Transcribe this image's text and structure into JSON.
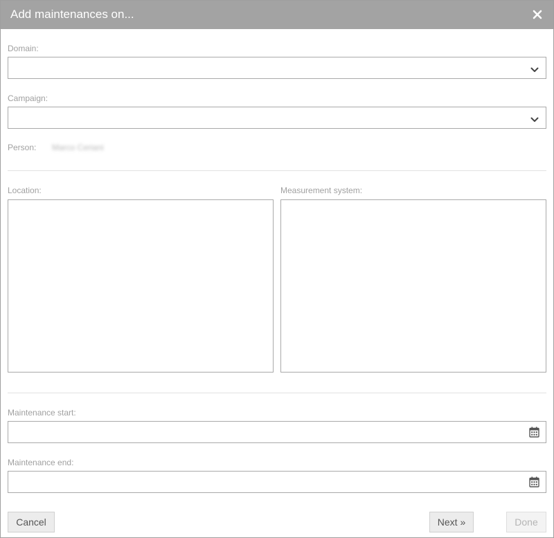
{
  "dialog": {
    "title": "Add maintenances on...",
    "close_icon": "close-icon"
  },
  "form": {
    "domain": {
      "label": "Domain:",
      "value": "",
      "icon": "chevron-down-icon"
    },
    "campaign": {
      "label": "Campaign:",
      "value": "",
      "icon": "chevron-down-icon"
    },
    "person": {
      "label": "Person:",
      "value": "Marco Ceriani"
    },
    "location": {
      "label": "Location:"
    },
    "measurement_system": {
      "label": "Measurement system:"
    },
    "maintenance_start": {
      "label": "Maintenance start:",
      "value": "",
      "icon": "calendar-icon"
    },
    "maintenance_end": {
      "label": "Maintenance end:",
      "value": "",
      "icon": "calendar-icon"
    }
  },
  "buttons": {
    "cancel": "Cancel",
    "next": "Next »",
    "done": "Done"
  }
}
